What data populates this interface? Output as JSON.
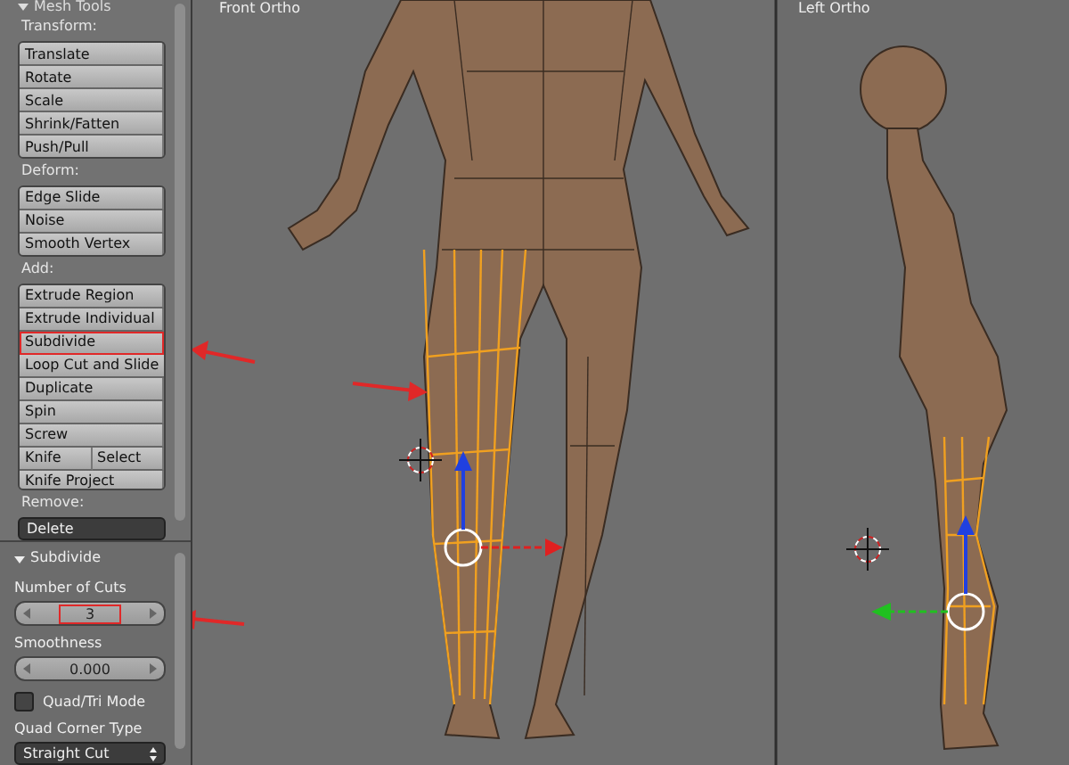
{
  "panel": {
    "header": "Mesh Tools",
    "sections": [
      {
        "label": "Transform:",
        "rows": [
          [
            {
              "label": "Translate",
              "highlighted": false
            }
          ],
          [
            {
              "label": "Rotate",
              "highlighted": false
            }
          ],
          [
            {
              "label": "Scale",
              "highlighted": false
            }
          ],
          [
            {
              "label": "Shrink/Fatten",
              "highlighted": false
            }
          ],
          [
            {
              "label": "Push/Pull",
              "highlighted": false
            }
          ]
        ]
      },
      {
        "label": "Deform:",
        "rows": [
          [
            {
              "label": "Edge Slide",
              "highlighted": false
            }
          ],
          [
            {
              "label": "Noise",
              "highlighted": false
            }
          ],
          [
            {
              "label": "Smooth Vertex",
              "highlighted": false
            }
          ]
        ]
      },
      {
        "label": "Add:",
        "rows": [
          [
            {
              "label": "Extrude Region",
              "highlighted": false
            }
          ],
          [
            {
              "label": "Extrude Individual",
              "highlighted": false
            }
          ],
          [
            {
              "label": "Subdivide",
              "highlighted": true
            }
          ],
          [
            {
              "label": "Loop Cut and Slide",
              "highlighted": false
            }
          ],
          [
            {
              "label": "Duplicate",
              "highlighted": false
            }
          ],
          [
            {
              "label": "Spin",
              "highlighted": false
            }
          ],
          [
            {
              "label": "Screw",
              "highlighted": false
            }
          ],
          [
            {
              "label": "Knife",
              "highlighted": false
            },
            {
              "label": "Select",
              "highlighted": false
            }
          ],
          [
            {
              "label": "Knife Project",
              "highlighted": false
            }
          ]
        ]
      },
      {
        "label": "Remove:",
        "dropdown": "Delete"
      }
    ]
  },
  "operator": {
    "title": "Subdivide",
    "expanded": true,
    "number_of_cuts": {
      "label": "Number of Cuts",
      "value": "3",
      "highlighted": true
    },
    "smoothness": {
      "label": "Smoothness",
      "value": "0.000"
    },
    "quad_tri": {
      "label": "Quad/Tri Mode",
      "checked": false
    },
    "corner_type": {
      "label": "Quad Corner Type",
      "value": "Straight Cut"
    }
  },
  "viewports": [
    {
      "title": "Front Ortho"
    },
    {
      "title": "Left Ortho"
    }
  ]
}
